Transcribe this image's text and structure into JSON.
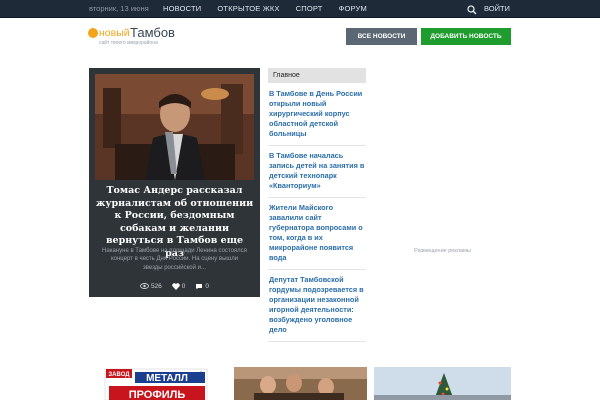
{
  "topbar": {
    "date": "вторник, 13 июня",
    "nav": [
      "НОВОСТИ",
      "ОТКРЫТОЕ ЖКХ",
      "СПОРТ",
      "ФОРУМ"
    ],
    "login": "ВОЙТИ"
  },
  "logo": {
    "word1": "новый",
    "word2": "Тамбов",
    "tagline": "сайт твоего микрорайона"
  },
  "header": {
    "all_news": "ВСЕ НОВОСТИ",
    "add_news": "ДОБАВИТЬ НОВОСТЬ"
  },
  "feature": {
    "title": "Томас Андерс рассказал журналистам об отношении к России, бездомным собакам и желании вернуться в Тамбов еще раз",
    "lead": "Накануне в Тамбове на площади Ленина состоялся концерт в честь Дня России. На сцену вышли звезды российской и...",
    "views": "526",
    "likes": "0",
    "comments": "0"
  },
  "main": {
    "heading": "Главное",
    "items": [
      "В Тамбове в День России открыли новый хирургический корпус областной детской больницы",
      "В Тамбове началась запись детей на занятия в детский технопарк «Кванториум»",
      "Жители Майского завалили сайт губернатора вопросами о том, когда в их микрорайоне появится вода",
      "Депутат Тамбовской гордумы подозревается в организации незаконной игорной деятельности: возбуждено уголовное дело"
    ]
  },
  "ad": {
    "label": "Размещение рекламы"
  },
  "thumbs": {
    "brand_top": "ЗАВОД",
    "brand_name1": "МЕТАЛЛ",
    "brand_name2": "ПРОФИЛЬ"
  }
}
